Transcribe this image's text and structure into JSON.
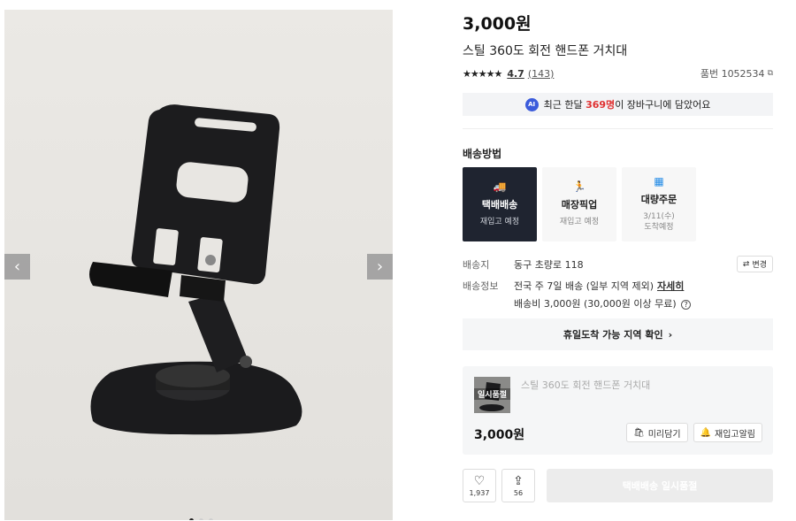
{
  "product": {
    "price": "3,000원",
    "title": "스틸 360도 회전 핸드폰 거치대",
    "stars": "★★★★★",
    "rating": "4.7",
    "review_count": "(143)",
    "sku": "품번 1052534"
  },
  "ai_banner": {
    "badge": "AI",
    "prefix": "최근 한달",
    "count": "369명",
    "suffix": "이 장바구니에 담았어요"
  },
  "delivery": {
    "title": "배송방법",
    "options": [
      {
        "label": "택배배송",
        "sub": "재입고 예정",
        "icon": "truck-icon"
      },
      {
        "label": "매장픽업",
        "sub": "재입고 예정",
        "icon": "pickup-icon"
      },
      {
        "label": "대량주문",
        "sub": "3/11(수)\n도착예정",
        "icon": "bulk-icon"
      }
    ]
  },
  "shipping": {
    "dest_key": "배송지",
    "dest_value": "동구 초량로 118",
    "change_label": "변경",
    "info_key": "배송정보",
    "info_line1": "전국 주 7일 배송 (일부 지역 제외)",
    "detail_link": "자세히",
    "info_line2": "배송비 3,000원 (30,000원 이상 무료)"
  },
  "holiday": {
    "label": "휴일도착 가능 지역 확인"
  },
  "option": {
    "thumb_label": "일시품절",
    "name": "스틸 360도 회전 핸드폰 거치대",
    "price": "3,000원",
    "btn_prelist": "미리담기",
    "btn_restock": "재입고알림"
  },
  "bottom": {
    "like_count": "1,937",
    "share_count": "56",
    "buy_label": "택배배송 일시품절"
  },
  "colors": {
    "accent_dark": "#1f2430",
    "ai_blue": "#3b5bdb",
    "highlight_red": "#e03131"
  }
}
